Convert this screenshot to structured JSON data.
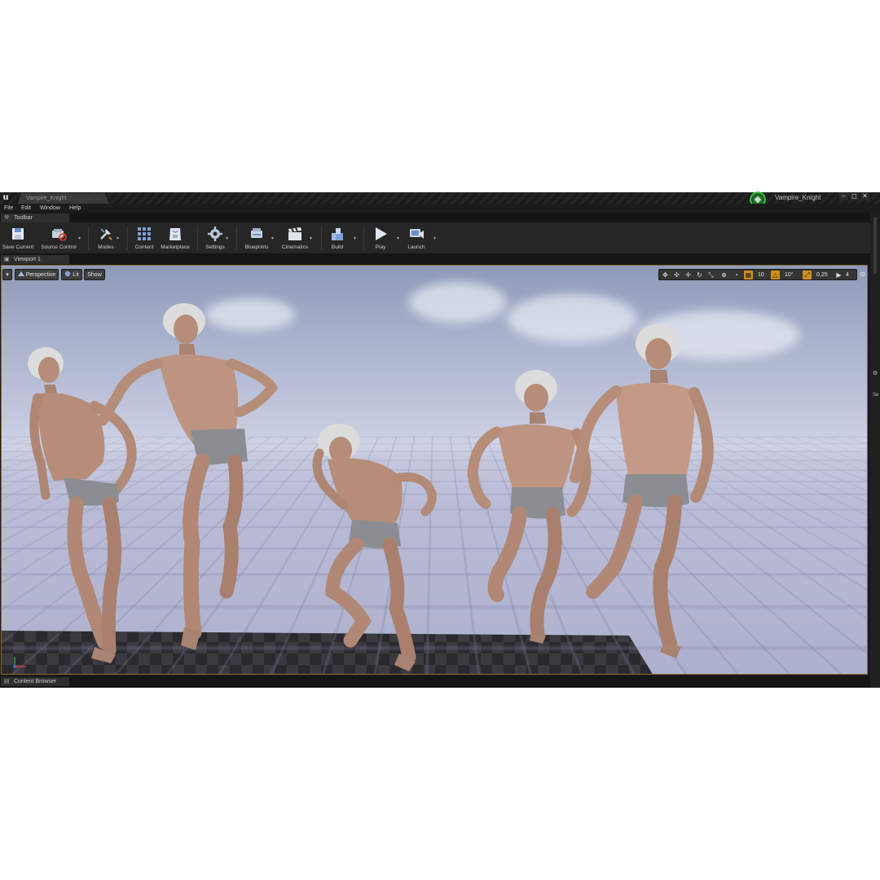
{
  "window": {
    "document_tab": "Vampire_Knight",
    "project_name": "Vampire_Knight",
    "logo_glyph": "u",
    "controls": {
      "minimize": "–",
      "maximize": "◻",
      "close": "✕"
    }
  },
  "menu": {
    "items": [
      {
        "label": "File"
      },
      {
        "label": "Edit"
      },
      {
        "label": "Window"
      },
      {
        "label": "Help"
      }
    ]
  },
  "toolbar_tab": {
    "label": "Toolbar"
  },
  "toolbar": {
    "buttons": [
      {
        "key": "save-current",
        "label": "Save Current",
        "icon": "save-icon",
        "dropdown": false
      },
      {
        "key": "source-control",
        "label": "Source Control",
        "icon": "source-control-icon",
        "dropdown": true
      },
      {
        "key": "modes",
        "label": "Modes",
        "icon": "modes-icon",
        "dropdown": true
      },
      {
        "key": "content",
        "label": "Content",
        "icon": "content-icon",
        "dropdown": false
      },
      {
        "key": "marketplace",
        "label": "Marketplace",
        "icon": "marketplace-icon",
        "dropdown": false
      },
      {
        "key": "settings",
        "label": "Settings",
        "icon": "settings-icon",
        "dropdown": true
      },
      {
        "key": "blueprints",
        "label": "Blueprints",
        "icon": "blueprints-icon",
        "dropdown": true
      },
      {
        "key": "cinematics",
        "label": "Cinematics",
        "icon": "cinematics-icon",
        "dropdown": true
      },
      {
        "key": "build",
        "label": "Build",
        "icon": "build-icon",
        "dropdown": true
      },
      {
        "key": "play",
        "label": "Play",
        "icon": "play-icon",
        "dropdown": true
      },
      {
        "key": "launch",
        "label": "Launch",
        "icon": "launch-icon",
        "dropdown": true
      }
    ]
  },
  "viewport_tab": {
    "label": "Viewport 1"
  },
  "viewport": {
    "view_mode": "Perspective",
    "lighting": "Lit",
    "show": "Show",
    "grid_snap": "10",
    "rotation_snap": "10°",
    "scale_snap": "0,25",
    "camera_speed": "4"
  },
  "content_browser_tab": {
    "label": "Content Browser"
  },
  "right_panel": {
    "label": "Se"
  },
  "colors": {
    "accent": "#d08c1e",
    "project_badge": "#2fbf3f",
    "viewport_border": "#8a6d2e",
    "skin": "#b58d78",
    "hair": "#dcdcdc",
    "shorts": "#8a8e92"
  }
}
